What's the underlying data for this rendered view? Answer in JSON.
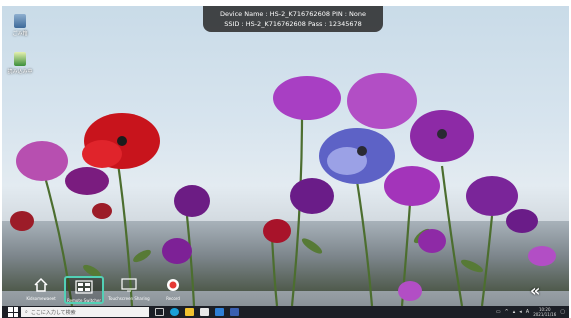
{
  "desktop": {
    "icons": [
      {
        "label": "ごみ箱",
        "name": "recycle-bin"
      },
      {
        "label": "読み込み中",
        "name": "app-shortcut"
      }
    ]
  },
  "banner": {
    "line1": "Device Name : HS-2_K716762608   PIN : None",
    "line2": "SSID : HS-2_K716762608   Pass : 12345678"
  },
  "dock": {
    "items": [
      {
        "label": "Kidsomewaeet",
        "icon": "home-icon"
      },
      {
        "label": "Remote Switcher",
        "icon": "grid-icon"
      },
      {
        "label": "Touchscreen Sharing",
        "icon": "screen-share-icon"
      },
      {
        "label": "Record",
        "icon": "record-icon"
      }
    ],
    "collapse": "«"
  },
  "taskbar": {
    "search_placeholder": "ここに入力して検索",
    "time": "10:20",
    "date": "2021/11/16"
  },
  "colors": {
    "accent": "#52d0b5",
    "taskbar": "#1c1f26"
  }
}
